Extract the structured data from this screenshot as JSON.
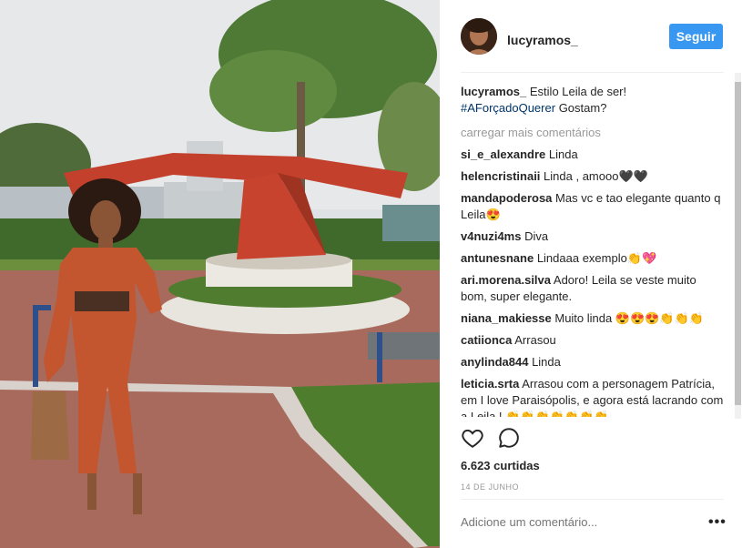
{
  "post": {
    "username": "lucyramos_",
    "follow_label": "Seguir",
    "caption_text": "Estilo Leila de ser!",
    "caption_hashtag": "#AForçadoQuerer",
    "caption_tail": "Gostam?",
    "load_more": "carregar mais comentários",
    "likes": "6.623 curtidas",
    "date": "14 DE JUNHO",
    "add_comment_placeholder": "Adicione um comentário...",
    "more_options": "•••"
  },
  "comments": [
    {
      "user": "si_e_alexandre",
      "text": "Linda"
    },
    {
      "user": "helencristinaii",
      "text": "Linda , amooo🖤🖤"
    },
    {
      "user": "mandapoderosa",
      "text": "Mas vc e tao elegante quanto q Leila😍"
    },
    {
      "user": "v4nuzi4ms",
      "text": "Diva"
    },
    {
      "user": "antunesnane",
      "text": "Lindaaa exemplo👏💖"
    },
    {
      "user": "ari.morena.silva",
      "text": "Adoro! Leila se veste muito bom, super elegante."
    },
    {
      "user": "niana_makiesse",
      "text": "Muito linda 😍😍😍👏👏👏"
    },
    {
      "user": "catiionca",
      "text": "Arrasou"
    },
    {
      "user": "anylinda844",
      "text": "Linda"
    },
    {
      "user": "leticia.srta",
      "text": "Arrasou com a personagem Patrícia, em I love Paraisópolis, e agora está lacrando com a Leila ! 👏👏👏👏👏👏👏"
    }
  ],
  "icons": {
    "like": "heart-icon",
    "comment": "comment-bubble-icon",
    "more": "more-options-icon"
  },
  "colors": {
    "accent": "#3897f0",
    "hashtag": "#003569",
    "muted": "#999999",
    "text": "#262626"
  }
}
